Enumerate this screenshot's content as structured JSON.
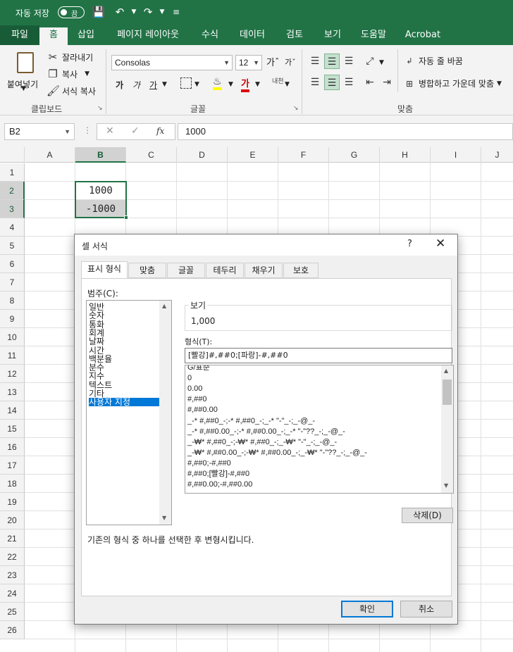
{
  "titlebar": {
    "autosave_label": "자동 저장",
    "toggle_state": "끔"
  },
  "ribbon_tabs": [
    "파일",
    "홈",
    "삽입",
    "페이지 레이아웃",
    "수식",
    "데이터",
    "검토",
    "보기",
    "도움말",
    "Acrobat"
  ],
  "ribbon": {
    "clipboard": {
      "paste": "붙여넣기",
      "cut": "잘라내기",
      "copy": "복사",
      "format_painter": "서식 복사",
      "group": "클립보드"
    },
    "font": {
      "name": "Consolas",
      "size": "12",
      "group": "글꼴",
      "bold": "가",
      "italic": "가",
      "underline": "가",
      "color_letter": "가",
      "phonetic": "내천"
    },
    "alignment": {
      "wrap_text": "자동 줄 바꿈",
      "merge_center": "병합하고 가운데 맞춤",
      "group": "맞춤"
    }
  },
  "formula_bar": {
    "name_box": "B2",
    "fx": "fx",
    "content": "1000"
  },
  "grid": {
    "columns": [
      "A",
      "B",
      "C",
      "D",
      "E",
      "F",
      "G",
      "H",
      "I",
      "J"
    ],
    "rows": [
      "1",
      "2",
      "3",
      "4",
      "5",
      "6",
      "7",
      "8",
      "9",
      "10",
      "11",
      "12",
      "13",
      "14",
      "15",
      "16",
      "17",
      "18",
      "19",
      "20",
      "21",
      "22",
      "23",
      "24",
      "25",
      "26"
    ],
    "cells": {
      "B2": "1000",
      "B3": "-1000"
    }
  },
  "dialog": {
    "title": "셀 서식",
    "help": "?",
    "close": "✕",
    "tabs": [
      "표시 형식",
      "맞춤",
      "글꼴",
      "테두리",
      "채우기",
      "보호"
    ],
    "category_label": "범주(C):",
    "categories": [
      "일반",
      "숫자",
      "통화",
      "회계",
      "날짜",
      "시간",
      "백분율",
      "분수",
      "지수",
      "텍스트",
      "기타",
      "사용자 지정"
    ],
    "preview_label": "보기",
    "preview_value": "1,000",
    "type_label": "형식(T):",
    "type_value": "[빨강]#,##0;[파랑]-#,##0",
    "format_list": [
      "G/표준",
      "0",
      "0.00",
      "#,##0",
      "#,##0.00",
      "_-* #,##0_-;-* #,##0_-;_-* \"-\"_-;_-@_-",
      "_-* #,##0.00_-;-* #,##0.00_-;_-* \"-\"??_-;_-@_-",
      "_-₩* #,##0_-;-₩* #,##0_-;_-₩* \"-\"_-;_-@_-",
      "_-₩* #,##0.00_-;-₩* #,##0.00_-;_-₩* \"-\"??_-;_-@_-",
      "#,##0;-#,##0",
      "#,##0;[빨강]-#,##0",
      "#,##0.00;-#,##0.00"
    ],
    "delete_button": "삭제(D)",
    "description": "기존의 형식 중 하나를 선택한 후 변형시킵니다.",
    "ok_button": "확인",
    "cancel_button": "취소"
  }
}
